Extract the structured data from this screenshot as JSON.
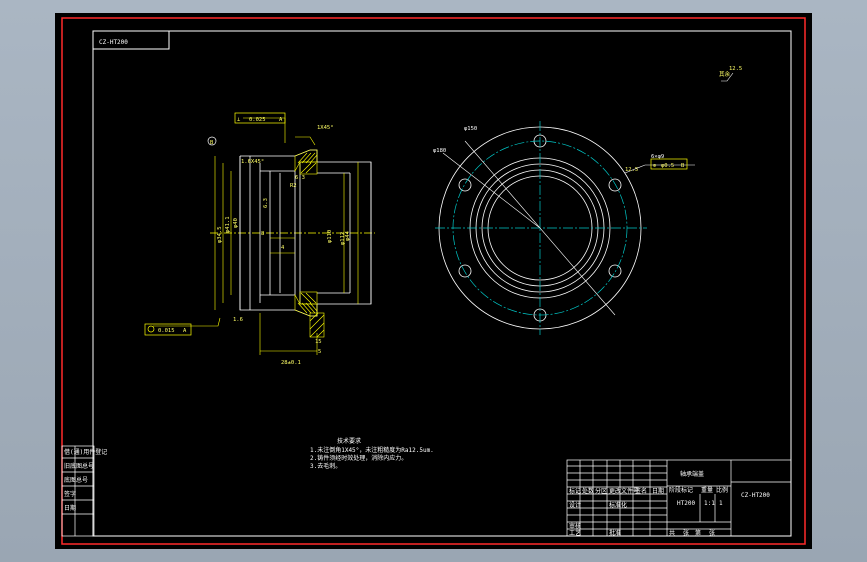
{
  "colors": {
    "background": "#000000",
    "outer_border": "#ff2a2a",
    "line": "#ffffff",
    "annotation": "#ffff00",
    "center_line": "#00c8c8",
    "hatch": "#ffff00"
  },
  "section_view": {
    "labels": {
      "flatness_tol": "0.025",
      "datum_a": "A",
      "datum_b": "B",
      "chamfer_top": "1X45°",
      "chamfer_left": "1.6X45°",
      "dia_a": "φ34.5",
      "dia_b": "φ41.1",
      "dia_c": "φ40",
      "dia_d": "φ44",
      "dia_e": "φ110",
      "dia_f": "φ112",
      "len_1": "8",
      "len_2": "4",
      "len_3": "28±0.1",
      "len_4": "15",
      "rough_1": "6.3",
      "rough_2": "1.6",
      "rough_3": "6.3",
      "runout_tol": "0.015",
      "runout_datum": "A",
      "width_tol": "5",
      "radius_r": "R2"
    }
  },
  "plan_view": {
    "labels": {
      "bolt_circle": "φ150",
      "outer_dia": "φ180",
      "hole_note": "6×φ9",
      "position_tol": "φ0.5",
      "position_datum": "B",
      "rough_top": "12.5"
    }
  },
  "top_right_mark": {
    "roughness": "12.5",
    "prefix": "其余"
  },
  "tech_requirements": {
    "title": "技术要求",
    "items": [
      "1.未注倒角1X45°，未注粗糙度为Ra12.5um.",
      "2.铸件须经时效处理，消除内应力。",
      "3.去毛刺。"
    ]
  },
  "title_block": {
    "part_name": "轴承端盖",
    "drawing_no": "CZ-HT200",
    "material": "HT200",
    "scale": "1:1",
    "sheet": "1",
    "cells": [
      "设计",
      "标准化",
      "审核",
      "工艺",
      "批准",
      "日期",
      "签名",
      "更改文件号",
      "标记",
      "处数",
      "分区",
      "共",
      "张",
      "第",
      "张",
      "重量",
      "比例",
      "阶段标记"
    ]
  },
  "left_stamp": {
    "rows": [
      "借(通)用件登记",
      "旧底图总号",
      "底图总号",
      "签字",
      "日期"
    ]
  }
}
